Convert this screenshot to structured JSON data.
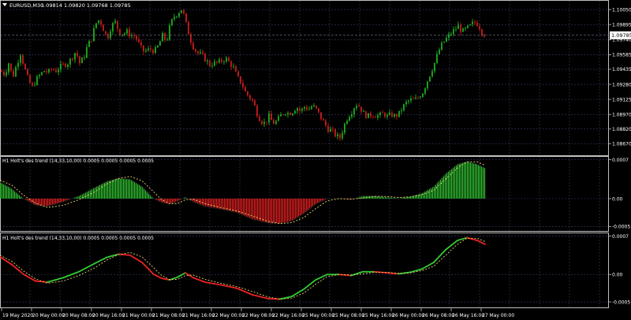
{
  "main_panel": {
    "symbol_caption": "EURUSD,M30",
    "ohlc_caption": "1.09814 1.09820 1.09768 1.09785",
    "price_ticks": [
      "1.10050",
      "1.09895",
      "1.09740",
      "1.09585",
      "1.09435",
      "1.09280",
      "1.09125",
      "1.08970",
      "1.08820",
      "1.08670"
    ],
    "current_price_label": "1.09785",
    "dropdown_icon": "triangle-down-icon"
  },
  "indicator1": {
    "caption": "H1 Holt's des trend (14,33,10,00) 0.0005 0.0005 0.0005 0.0005",
    "ticks": [
      "0.0007",
      "0.00",
      "-0.0005"
    ]
  },
  "indicator2": {
    "caption": "H1 Holt's des trend (14,33,10,00) 0.0005 0.0005 0.0005 0.0005",
    "ticks": [
      "0.0007",
      "0.00",
      "-0.0005"
    ]
  },
  "time_axis": {
    "labels": [
      "19 May 2020",
      "20 May 00:00",
      "20 May 08:00",
      "20 May 16:00",
      "21 May 00:00",
      "21 May 08:00",
      "21 May 16:00",
      "22 May 00:00",
      "22 May 08:00",
      "22 May 16:00",
      "25 May 00:00",
      "25 May 08:00",
      "25 May 16:00",
      "26 May 00:00",
      "26 May 08:00",
      "26 May 16:00",
      "27 May 00:00"
    ]
  },
  "colors": {
    "background": "#000000",
    "grid": "#3a3d66",
    "up_candle": "#22c322",
    "down_candle": "#e02020",
    "hist_up": "#33cc33",
    "hist_down": "#ee2222",
    "signal_line": "#e8d070",
    "axis_text": "#ffffff",
    "price_label_bg": "#ffffff"
  },
  "chart_data": [
    {
      "type": "candlestick",
      "title": "EURUSD,M30",
      "ylim": [
        1.0855,
        1.1014
      ],
      "price_path": [
        [
          0,
          1.0942
        ],
        [
          5,
          1.0938
        ],
        [
          10,
          1.095
        ],
        [
          15,
          1.0935
        ],
        [
          20,
          1.0948
        ],
        [
          25,
          1.096
        ],
        [
          30,
          1.0945
        ],
        [
          35,
          1.0932
        ],
        [
          40,
          1.0925
        ],
        [
          45,
          1.0933
        ],
        [
          50,
          1.0938
        ],
        [
          55,
          1.0942
        ],
        [
          60,
          1.094
        ],
        [
          65,
          1.0944
        ],
        [
          70,
          1.0942
        ],
        [
          75,
          1.0946
        ],
        [
          80,
          1.0948
        ],
        [
          85,
          1.095
        ],
        [
          90,
          1.0955
        ],
        [
          95,
          1.0962
        ],
        [
          100,
          1.095
        ],
        [
          105,
          1.0955
        ],
        [
          110,
          1.0968
        ],
        [
          115,
          1.0975
        ],
        [
          120,
          1.099
        ],
        [
          125,
          1.0995
        ],
        [
          130,
          1.0985
        ],
        [
          135,
          1.0975
        ],
        [
          140,
          1.0988
        ],
        [
          145,
          1.0992
        ],
        [
          150,
          1.0982
        ],
        [
          155,
          1.098
        ],
        [
          160,
          1.0982
        ],
        [
          165,
          1.0978
        ],
        [
          170,
          1.0978
        ],
        [
          175,
          1.097
        ],
        [
          180,
          1.0962
        ],
        [
          185,
          1.0963
        ],
        [
          190,
          1.0964
        ],
        [
          195,
          1.0962
        ],
        [
          200,
          1.0968
        ],
        [
          205,
          1.0978
        ],
        [
          210,
          1.0972
        ],
        [
          215,
          1.099
        ],
        [
          220,
          1.0998
        ],
        [
          225,
          1.1002
        ],
        [
          230,
          1.1006
        ],
        [
          235,
          1.099
        ],
        [
          240,
          1.0975
        ],
        [
          245,
          1.0965
        ],
        [
          250,
          1.096
        ],
        [
          255,
          1.0958
        ],
        [
          260,
          1.0953
        ],
        [
          265,
          1.0948
        ],
        [
          270,
          1.095
        ],
        [
          275,
          1.095
        ],
        [
          280,
          1.0952
        ],
        [
          285,
          1.0955
        ],
        [
          290,
          1.095
        ],
        [
          295,
          1.0945
        ],
        [
          300,
          1.0935
        ],
        [
          305,
          1.093
        ],
        [
          310,
          1.092
        ],
        [
          315,
          1.0915
        ],
        [
          320,
          1.091
        ],
        [
          325,
          1.0898
        ],
        [
          330,
          1.089
        ],
        [
          335,
          1.0888
        ],
        [
          340,
          1.0895
        ],
        [
          345,
          1.0888
        ],
        [
          350,
          1.089
        ],
        [
          355,
          1.0896
        ],
        [
          360,
          1.09
        ],
        [
          365,
          1.0898
        ],
        [
          370,
          1.09
        ],
        [
          375,
          1.0905
        ],
        [
          380,
          1.09
        ],
        [
          385,
          1.0905
        ],
        [
          390,
          1.0902
        ],
        [
          395,
          1.0906
        ],
        [
          400,
          1.0902
        ],
        [
          405,
          1.0895
        ],
        [
          410,
          1.0888
        ],
        [
          415,
          1.0882
        ],
        [
          420,
          1.088
        ],
        [
          425,
          1.0875
        ],
        [
          430,
          1.0873
        ],
        [
          435,
          1.0885
        ],
        [
          440,
          1.0895
        ],
        [
          445,
          1.09
        ],
        [
          450,
          1.0908
        ],
        [
          455,
          1.0905
        ],
        [
          460,
          1.0898
        ],
        [
          465,
          1.0895
        ],
        [
          470,
          1.0897
        ],
        [
          475,
          1.0896
        ],
        [
          480,
          1.0896
        ],
        [
          485,
          1.0898
        ],
        [
          490,
          1.0895
        ],
        [
          495,
          1.0897
        ],
        [
          500,
          1.0895
        ],
        [
          505,
          1.0898
        ],
        [
          510,
          1.0905
        ],
        [
          515,
          1.091
        ],
        [
          520,
          1.0912
        ],
        [
          525,
          1.0912
        ],
        [
          530,
          1.0915
        ],
        [
          535,
          1.092
        ],
        [
          540,
          1.093
        ],
        [
          545,
          1.094
        ],
        [
          550,
          1.095
        ],
        [
          555,
          1.0962
        ],
        [
          560,
          1.097
        ],
        [
          565,
          1.0975
        ],
        [
          570,
          1.098
        ],
        [
          575,
          1.0984
        ],
        [
          580,
          1.0988
        ],
        [
          585,
          1.0982
        ],
        [
          590,
          1.0985
        ],
        [
          595,
          1.0988
        ],
        [
          600,
          1.0992
        ],
        [
          605,
          1.099
        ],
        [
          610,
          1.0982
        ],
        [
          615,
          1.0978
        ]
      ],
      "current_price": 1.09785
    },
    {
      "type": "histogram",
      "title": "H1 Holt's des trend (14,33,10,00) 0.0005 0.0005 0.0005 0.0005",
      "ylim": [
        -0.00058,
        0.00075
      ],
      "histogram": [
        [
          0,
          0.0003
        ],
        [
          15,
          0.00018
        ],
        [
          30,
          0.0
        ],
        [
          45,
          -0.00012
        ],
        [
          60,
          -0.00014
        ],
        [
          80,
          -6e-05
        ],
        [
          100,
          5e-05
        ],
        [
          120,
          0.0002
        ],
        [
          135,
          0.00031
        ],
        [
          150,
          0.00037
        ],
        [
          165,
          0.00035
        ],
        [
          180,
          0.00022
        ],
        [
          195,
          0.0
        ],
        [
          205,
          -7e-05
        ],
        [
          215,
          -0.0001
        ],
        [
          225,
          -5e-05
        ],
        [
          235,
          3e-05
        ],
        [
          245,
          -6e-05
        ],
        [
          260,
          -0.00014
        ],
        [
          280,
          -0.00019
        ],
        [
          300,
          -0.00025
        ],
        [
          320,
          -0.00037
        ],
        [
          340,
          -0.00044
        ],
        [
          355,
          -0.00045
        ],
        [
          370,
          -0.0004
        ],
        [
          385,
          -0.00027
        ],
        [
          400,
          -0.0001
        ],
        [
          415,
          0.0
        ],
        [
          430,
          0.0
        ],
        [
          445,
          -2e-05
        ],
        [
          460,
          5e-05
        ],
        [
          475,
          5e-05
        ],
        [
          490,
          3e-05
        ],
        [
          505,
          1e-05
        ],
        [
          520,
          4e-05
        ],
        [
          535,
          0.0001
        ],
        [
          550,
          0.00022
        ],
        [
          565,
          0.00045
        ],
        [
          580,
          0.00062
        ],
        [
          592,
          0.00067
        ],
        [
          605,
          0.00062
        ],
        [
          615,
          0.00055
        ]
      ],
      "signal": [
        [
          0,
          0.00033
        ],
        [
          15,
          0.00024
        ],
        [
          30,
          6e-05
        ],
        [
          45,
          -8e-05
        ],
        [
          60,
          -0.00016
        ],
        [
          80,
          -0.00012
        ],
        [
          100,
          -2e-05
        ],
        [
          120,
          0.00012
        ],
        [
          135,
          0.00026
        ],
        [
          150,
          0.00036
        ],
        [
          165,
          0.0004
        ],
        [
          180,
          0.00032
        ],
        [
          195,
          0.00012
        ],
        [
          205,
          -2e-05
        ],
        [
          215,
          -9e-05
        ],
        [
          225,
          -9e-05
        ],
        [
          235,
          -2e-05
        ],
        [
          245,
          -1e-05
        ],
        [
          260,
          -9e-05
        ],
        [
          280,
          -0.00016
        ],
        [
          300,
          -0.00022
        ],
        [
          320,
          -0.00031
        ],
        [
          340,
          -0.00041
        ],
        [
          355,
          -0.00045
        ],
        [
          370,
          -0.00043
        ],
        [
          385,
          -0.00034
        ],
        [
          400,
          -0.00018
        ],
        [
          415,
          -4e-05
        ],
        [
          430,
          0.0
        ],
        [
          445,
          -1e-05
        ],
        [
          460,
          1e-05
        ],
        [
          475,
          4e-05
        ],
        [
          490,
          4e-05
        ],
        [
          505,
          2e-05
        ],
        [
          520,
          3e-05
        ],
        [
          535,
          7e-05
        ],
        [
          550,
          0.00015
        ],
        [
          565,
          0.00035
        ],
        [
          580,
          0.00055
        ],
        [
          592,
          0.00066
        ],
        [
          605,
          0.00066
        ],
        [
          615,
          0.0006
        ]
      ]
    },
    {
      "type": "line",
      "title": "H1 Holt's des trend (14,33,10,00) 0.0005 0.0005 0.0005 0.0005",
      "ylim": [
        -0.0006,
        0.00075
      ],
      "main_line": [
        [
          0,
          0.00032
        ],
        [
          15,
          0.00018
        ],
        [
          30,
          0.0
        ],
        [
          45,
          -0.00012
        ],
        [
          60,
          -0.00014
        ],
        [
          80,
          -6e-05
        ],
        [
          100,
          5e-05
        ],
        [
          120,
          0.0002
        ],
        [
          135,
          0.00031
        ],
        [
          150,
          0.00037
        ],
        [
          165,
          0.00035
        ],
        [
          180,
          0.00022
        ],
        [
          195,
          0.0
        ],
        [
          205,
          -7e-05
        ],
        [
          215,
          -0.0001
        ],
        [
          225,
          -5e-05
        ],
        [
          235,
          3e-05
        ],
        [
          245,
          -6e-05
        ],
        [
          260,
          -0.00014
        ],
        [
          280,
          -0.00019
        ],
        [
          300,
          -0.00025
        ],
        [
          320,
          -0.00037
        ],
        [
          340,
          -0.00044
        ],
        [
          355,
          -0.00045
        ],
        [
          370,
          -0.0004
        ],
        [
          385,
          -0.00027
        ],
        [
          400,
          -0.0001
        ],
        [
          415,
          0.0
        ],
        [
          430,
          0.0
        ],
        [
          445,
          -2e-05
        ],
        [
          460,
          5e-05
        ],
        [
          475,
          5e-05
        ],
        [
          490,
          3e-05
        ],
        [
          505,
          1e-05
        ],
        [
          520,
          4e-05
        ],
        [
          535,
          0.0001
        ],
        [
          550,
          0.00022
        ],
        [
          565,
          0.00045
        ],
        [
          580,
          0.00062
        ],
        [
          592,
          0.00067
        ],
        [
          605,
          0.00062
        ],
        [
          615,
          0.00055
        ]
      ],
      "signal": [
        [
          0,
          0.00035
        ],
        [
          15,
          0.00024
        ],
        [
          30,
          6e-05
        ],
        [
          45,
          -8e-05
        ],
        [
          60,
          -0.00016
        ],
        [
          80,
          -0.00012
        ],
        [
          100,
          -2e-05
        ],
        [
          120,
          0.00012
        ],
        [
          135,
          0.00026
        ],
        [
          150,
          0.00036
        ],
        [
          165,
          0.0004
        ],
        [
          180,
          0.00032
        ],
        [
          195,
          0.00012
        ],
        [
          205,
          -2e-05
        ],
        [
          215,
          -9e-05
        ],
        [
          225,
          -9e-05
        ],
        [
          235,
          -2e-05
        ],
        [
          245,
          -1e-05
        ],
        [
          260,
          -9e-05
        ],
        [
          280,
          -0.00016
        ],
        [
          300,
          -0.00022
        ],
        [
          320,
          -0.00031
        ],
        [
          340,
          -0.00041
        ],
        [
          355,
          -0.00045
        ],
        [
          370,
          -0.00043
        ],
        [
          385,
          -0.00034
        ],
        [
          400,
          -0.00018
        ],
        [
          415,
          -4e-05
        ],
        [
          430,
          0.0
        ],
        [
          445,
          -1e-05
        ],
        [
          460,
          1e-05
        ],
        [
          475,
          4e-05
        ],
        [
          490,
          4e-05
        ],
        [
          505,
          2e-05
        ],
        [
          520,
          3e-05
        ],
        [
          535,
          7e-05
        ],
        [
          550,
          0.00015
        ],
        [
          565,
          0.00035
        ],
        [
          580,
          0.00055
        ],
        [
          592,
          0.00066
        ],
        [
          605,
          0.00066
        ],
        [
          615,
          0.0006
        ]
      ]
    }
  ]
}
